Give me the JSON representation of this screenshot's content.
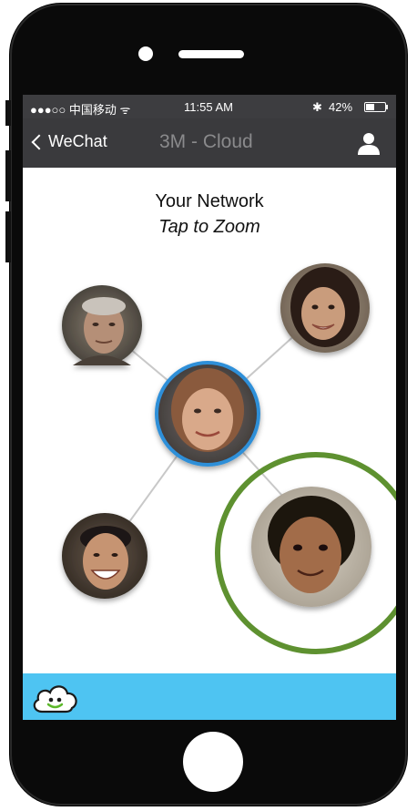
{
  "status_bar": {
    "carrier": "●●●○○ 中国移动 ᯤ",
    "time": "11:55 AM",
    "bluetooth": "✱",
    "battery": "42%",
    "battery_level": 0.42
  },
  "nav": {
    "back_label": "WeChat",
    "title": "3M - Cloud",
    "right_icon": "person-icon"
  },
  "content": {
    "heading": "Your Network",
    "subheading": "Tap to Zoom"
  },
  "network": {
    "center": "center-contact",
    "contacts": [
      {
        "id": "elderly-man",
        "icon": "avatar"
      },
      {
        "id": "smiling-woman",
        "icon": "avatar"
      },
      {
        "id": "center-woman",
        "icon": "avatar"
      },
      {
        "id": "laughing-man",
        "icon": "avatar"
      },
      {
        "id": "child",
        "icon": "avatar"
      }
    ],
    "highlighted": "child",
    "highlight_color": "#5e9130"
  },
  "bottom_bar": {
    "icon": "cloud-smile-icon",
    "color": "#4ec4f2"
  },
  "colors": {
    "phone_body": "#0a0a0a",
    "status_bar": "#3d3d40",
    "nav_bar": "#3a3a3d",
    "center_ring": "#2f8fd8"
  }
}
